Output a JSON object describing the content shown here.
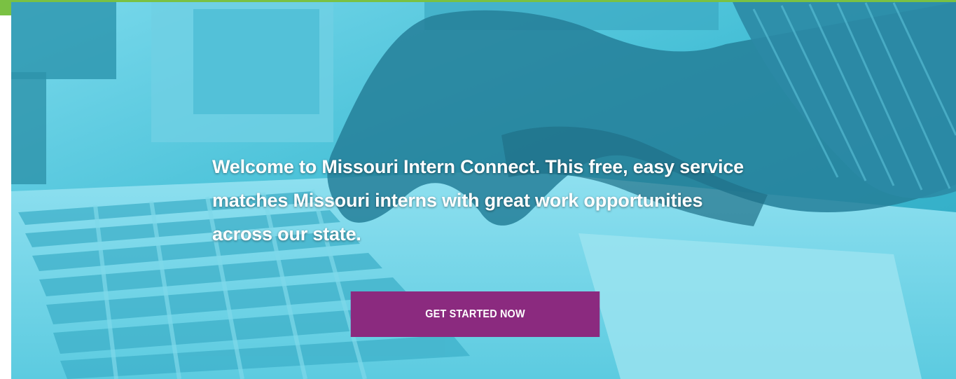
{
  "hero": {
    "message": "Welcome to Missouri Intern Connect. This free, easy service matches Missouri interns with great work opportunities across our state.",
    "cta_label": "GET STARTED NOW",
    "background_image": "hands-typing-on-laptop-keyboard"
  },
  "colors": {
    "overlay_tint": "#3fb9d1",
    "cta_background": "#8b2a7f",
    "cta_text": "#ffffff",
    "accent_strip": "#7ac143",
    "text": "#ffffff"
  }
}
